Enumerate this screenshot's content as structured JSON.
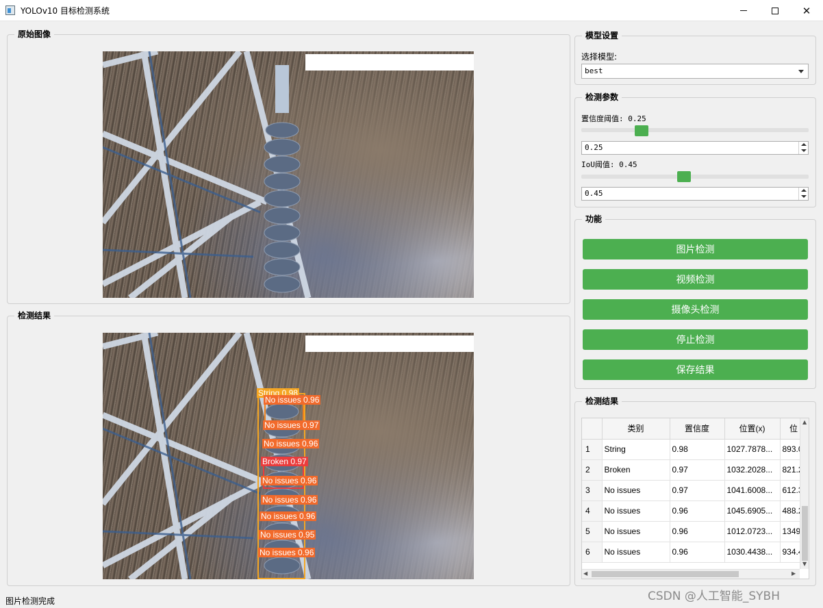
{
  "window": {
    "title": "YOLOv10 目标检测系统",
    "icon": "app-window-icon",
    "controls": [
      "minimize",
      "maximize",
      "close"
    ]
  },
  "panels": {
    "original": {
      "title": "原始图像"
    },
    "result": {
      "title": "检测结果"
    }
  },
  "detections": [
    {
      "label": "String 0.98",
      "kind": "string"
    },
    {
      "label": "No issues 0.96",
      "kind": "ok"
    },
    {
      "label": "No issues 0.97",
      "kind": "ok"
    },
    {
      "label": "No issues 0.96",
      "kind": "ok"
    },
    {
      "label": "Broken 0.97",
      "kind": "broken"
    },
    {
      "label": "No issues 0.96",
      "kind": "ok"
    },
    {
      "label": "No issues 0.96",
      "kind": "ok"
    },
    {
      "label": "No issues 0.96",
      "kind": "ok"
    },
    {
      "label": "No issues 0.95",
      "kind": "ok"
    },
    {
      "label": "No issues 0.96",
      "kind": "ok"
    }
  ],
  "model_settings": {
    "title": "模型设置",
    "select_label": "选择模型:",
    "selected_model": "best"
  },
  "detection_params": {
    "title": "检测参数",
    "confidence_label": "置信度阈值: 0.25",
    "confidence_value": "0.25",
    "confidence_level": 0.25,
    "iou_label": "IoU阈值: 0.45",
    "iou_value": "0.45",
    "iou_level": 0.45
  },
  "functions": {
    "title": "功能",
    "buttons": [
      "图片检测",
      "视频检测",
      "摄像头检测",
      "停止检测",
      "保存结果"
    ]
  },
  "results_table": {
    "title": "检测结果",
    "columns": [
      "类别",
      "置信度",
      "位置(x)",
      "位"
    ],
    "rows": [
      {
        "num": "1",
        "cells": [
          "String",
          "0.98",
          "1027.7878...",
          "893.0"
        ]
      },
      {
        "num": "2",
        "cells": [
          "Broken",
          "0.97",
          "1032.2028...",
          "821.2"
        ]
      },
      {
        "num": "3",
        "cells": [
          "No issues",
          "0.97",
          "1041.6008...",
          "612.3"
        ]
      },
      {
        "num": "4",
        "cells": [
          "No issues",
          "0.96",
          "1045.6905...",
          "488.2"
        ]
      },
      {
        "num": "5",
        "cells": [
          "No issues",
          "0.96",
          "1012.0723...",
          "1349"
        ]
      },
      {
        "num": "6",
        "cells": [
          "No issues",
          "0.96",
          "1030.4438...",
          "934.4"
        ]
      }
    ]
  },
  "status_bar": {
    "text": "图片检测完成"
  },
  "watermark": "CSDN @人工智能_SYBH"
}
